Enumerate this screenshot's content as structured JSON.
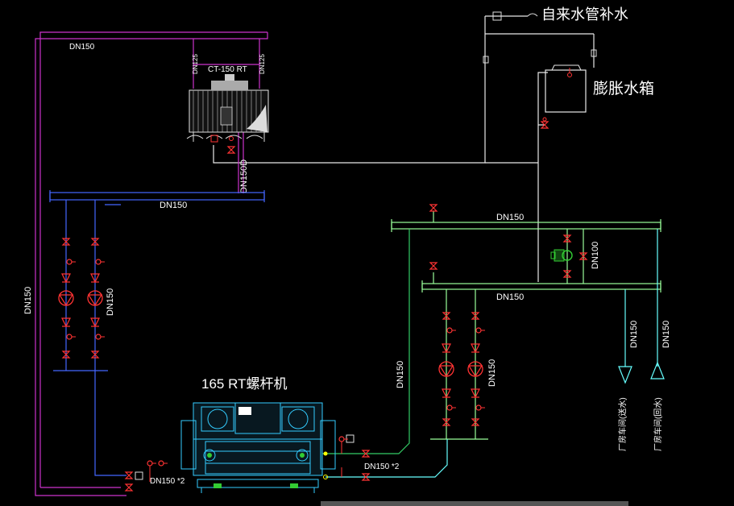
{
  "labels": {
    "city_water": "自来水管补水",
    "expansion_tank": "膨胀水箱",
    "cooling_tower": "CT-150 RT",
    "chiller": "165 RT螺杆机",
    "dn125_a": "DN125",
    "dn125_b": "DN125",
    "dn150_top": "DN150",
    "dn150_left_vertical": "DN150",
    "dn150_cooling_header": "DN150",
    "dn150_cooling_pumps": "DN150",
    "dn150_tower_drop": "DN150D",
    "dn150_chw_header_top": "DN150",
    "dn150_chw_header_bottom": "DN150",
    "dn100_bypass": "DN100",
    "dn150_chw_riser": "DN150",
    "dn150_chw_pumps": "DN150",
    "dn150_supply": "DN150",
    "dn150_return": "DN150",
    "dn150x2_cond": "DN150 *2",
    "dn150x2_evap": "DN150 *2",
    "plant_supply": "厂房车间(送水)",
    "plant_return": "厂房车间(回水)"
  },
  "colors": {
    "background": "#000000",
    "condenser_pipe": "#cc33cc",
    "city_water_pipe": "#ffffff",
    "cooling_header": "#4466ff",
    "chw_header": "#99ff99",
    "chw_pipe": "#33cc66",
    "supply_return": "#66ffff",
    "valve": "#ff3333",
    "chiller_body": "#33ccff",
    "bypass_valve": "#33cc33",
    "equipment_outline": "#ffffff"
  },
  "icons": [
    "gate-valve-icon",
    "pump-icon",
    "check-valve-icon",
    "strainer-icon",
    "gauge-icon",
    "bypass-valve-icon",
    "arrow-down-icon",
    "arrow-up-icon"
  ]
}
